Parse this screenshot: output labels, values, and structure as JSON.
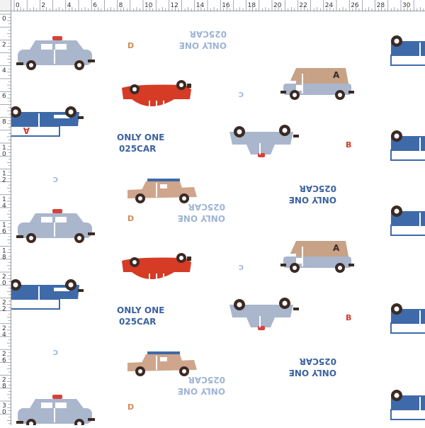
{
  "rulers": {
    "top_labels": [
      "0",
      "2",
      "4",
      "6",
      "8",
      "10",
      "12",
      "14",
      "16",
      "18",
      "20",
      "22",
      "24",
      "26",
      "28",
      "30"
    ],
    "left_labels": [
      "0",
      "2",
      "4",
      "6",
      "8",
      "10",
      "12",
      "14",
      "16",
      "18",
      "20",
      "22",
      "24",
      "26",
      "28",
      "30"
    ]
  },
  "pattern": {
    "slogan_line1": "ONLY ONE",
    "slogan_line2": "025CAR",
    "letters": {
      "a": "A",
      "b": "B",
      "c": "C",
      "d": "D"
    }
  },
  "colors": {
    "police_blue": "#a9b6cc",
    "police_light": "#d8413a",
    "dark_blue": "#3e6aa9",
    "red": "#d53b25",
    "tan": "#cfa58b",
    "brown_roof": "#c8a286",
    "wheel": "#3b2a24",
    "text_blue": "#3c62a0",
    "text_light": "#9eb4d6",
    "letter_orange": "#d48a53",
    "letter_red": "#d53b25"
  }
}
